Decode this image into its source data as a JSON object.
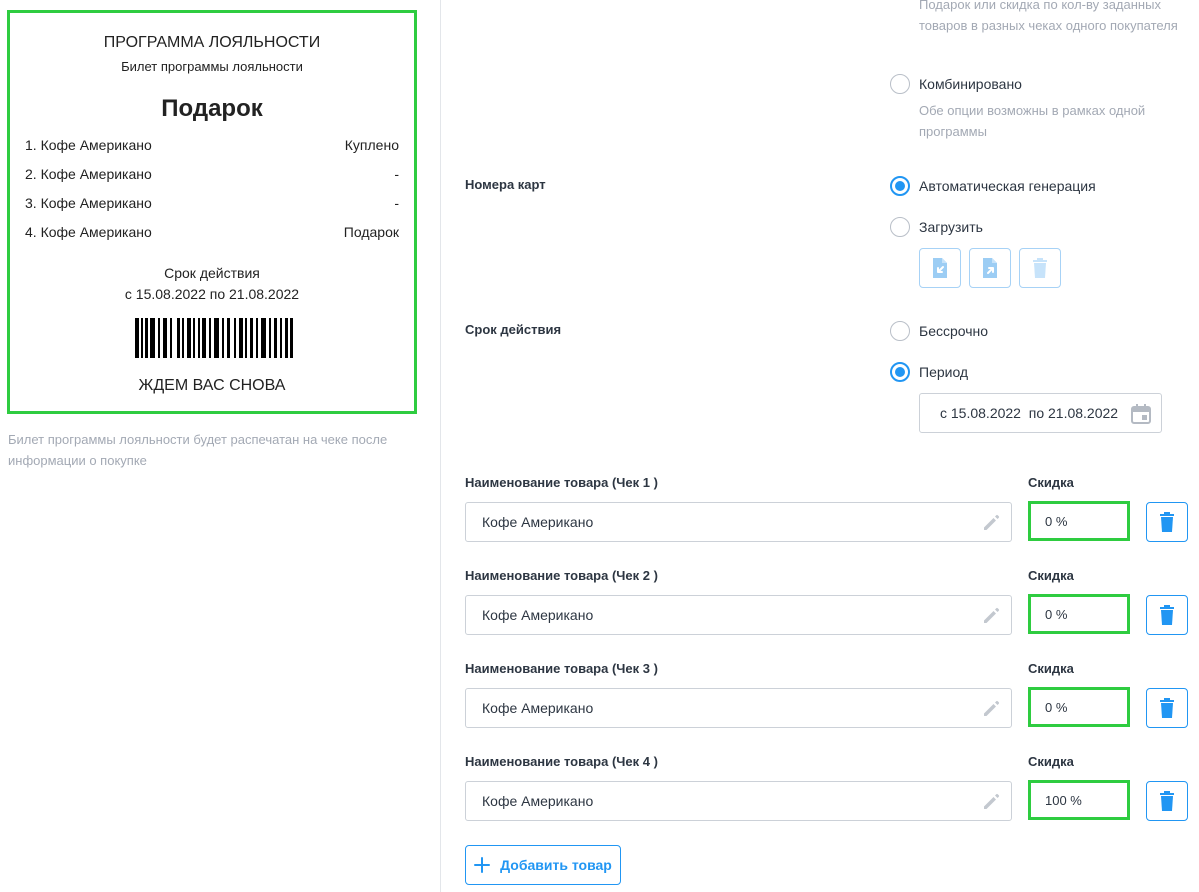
{
  "ticket": {
    "title": "ПРОГРАММА ЛОЯЛЬНОСТИ",
    "subtitle": "Билет программы лояльности",
    "gift": "Подарок",
    "items": [
      {
        "name": "1. Кофе Американо",
        "status": "Куплено"
      },
      {
        "name": "2. Кофе Американо",
        "status": "-"
      },
      {
        "name": "3. Кофе Американо",
        "status": "-"
      },
      {
        "name": "4. Кофе Американо",
        "status": "Подарок"
      }
    ],
    "validity_label": "Срок действия",
    "validity_range": "с 15.08.2022 по 21.08.2022",
    "farewell": "ЖДЕМ ВАС СНОВА"
  },
  "ticket_note": "Билет программы лояльности будет распечатан на чеке после информации о покупке",
  "program_type": {
    "top_description": "Подарок или скидка по кол-ву заданных товаров в разных чеках одного покупателя",
    "combined_label": "Комбинировано",
    "combined_description": "Обе опции возможны в рамках одной программы"
  },
  "card_numbers": {
    "label": "Номера карт",
    "auto_label": "Автоматическая генерация",
    "upload_label": "Загрузить"
  },
  "validity": {
    "label": "Срок действия",
    "unlimited_label": "Бессрочно",
    "period_label": "Период",
    "date_range": "с 15.08.2022  по 21.08.2022"
  },
  "products": [
    {
      "label": "Наименование товара (Чек 1 )",
      "value": "Кофе Американо",
      "discount_label": "Скидка",
      "discount": "0 %"
    },
    {
      "label": "Наименование товара (Чек 2 )",
      "value": "Кофе Американо",
      "discount_label": "Скидка",
      "discount": "0 %"
    },
    {
      "label": "Наименование товара (Чек 3 )",
      "value": "Кофе Американо",
      "discount_label": "Скидка",
      "discount": "0 %"
    },
    {
      "label": "Наименование товара (Чек 4 )",
      "value": "Кофе Американо",
      "discount_label": "Скидка",
      "discount": "100 %"
    }
  ],
  "add_product_label": "Добавить товар",
  "colors": {
    "accent": "#2196f3",
    "highlight": "#2ecc40",
    "muted_text": "#a3a9b4"
  },
  "icons": [
    "file-import-icon",
    "file-export-icon",
    "trash-icon",
    "calendar-icon",
    "pencil-icon",
    "plus-icon",
    "barcode-icon"
  ]
}
